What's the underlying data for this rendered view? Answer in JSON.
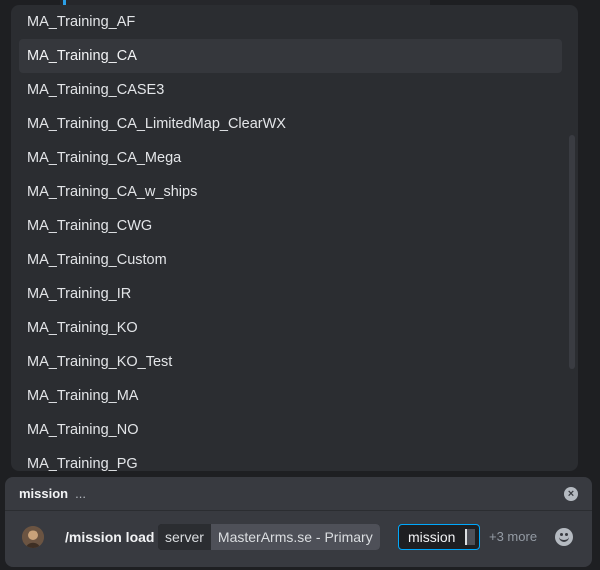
{
  "popup": {
    "options": [
      {
        "label": "MA_Training_AF",
        "active": false
      },
      {
        "label": "MA_Training_CA",
        "active": true
      },
      {
        "label": "MA_Training_CASE3",
        "active": false
      },
      {
        "label": "MA_Training_CA_LimitedMap_ClearWX",
        "active": false
      },
      {
        "label": "MA_Training_CA_Mega",
        "active": false
      },
      {
        "label": "MA_Training_CA_w_ships",
        "active": false
      },
      {
        "label": "MA_Training_CWG",
        "active": false
      },
      {
        "label": "MA_Training_Custom",
        "active": false
      },
      {
        "label": "MA_Training_IR",
        "active": false
      },
      {
        "label": "MA_Training_KO",
        "active": false
      },
      {
        "label": "MA_Training_KO_Test",
        "active": false
      },
      {
        "label": "MA_Training_MA",
        "active": false
      },
      {
        "label": "MA_Training_NO",
        "active": false
      },
      {
        "label": "MA_Training_PG",
        "active": false
      }
    ]
  },
  "command_bar": {
    "option_name": "mission",
    "ellipsis": "...",
    "close_icon": "close-circle-icon",
    "command": "/mission load",
    "params": [
      {
        "name": "server",
        "value": "MasterArms.se - Primary"
      }
    ],
    "active_param": "mission",
    "more": "+3 more",
    "emoji_icon": "smiley-face-icon"
  },
  "colors": {
    "background": "#1e1f22",
    "popup": "#2b2d31",
    "active_option": "#35373c",
    "command_bar": "#383a40",
    "accent": "#00a8fc"
  }
}
